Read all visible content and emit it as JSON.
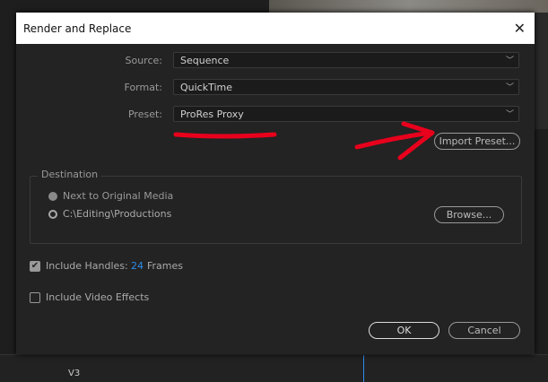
{
  "dialog": {
    "title": "Render and Replace"
  },
  "fields": {
    "source_label": "Source:",
    "source_value": "Sequence",
    "format_label": "Format:",
    "format_value": "QuickTime",
    "preset_label": "Preset:",
    "preset_value": "ProRes Proxy"
  },
  "import_preset": "Import Preset...",
  "destination": {
    "legend": "Destination",
    "option1": "Next to Original Media",
    "option2": "C:\\Editing\\Productions",
    "browse": "Browse..."
  },
  "handles": {
    "label": "Include Handles:",
    "value": "24",
    "unit": "Frames",
    "checked": true
  },
  "effects": {
    "label": "Include Video Effects",
    "checked": false
  },
  "buttons": {
    "ok": "OK",
    "cancel": "Cancel"
  },
  "background": {
    "track_label": "V3"
  },
  "colors": {
    "accent": "#2d8ceb",
    "annotation": "#e8001c"
  }
}
